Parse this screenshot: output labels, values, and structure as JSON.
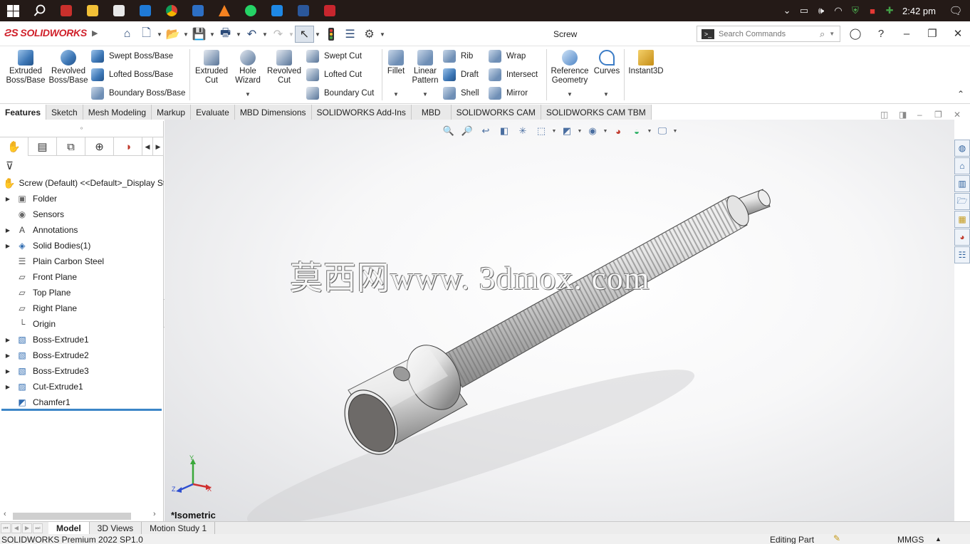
{
  "taskbar": {
    "clock": "2:42 pm",
    "apps": [
      "windows-start",
      "search",
      "calendar-2022",
      "file-explorer",
      "store",
      "mail",
      "chrome",
      "generic-app",
      "vlc",
      "whatsapp",
      "vscode",
      "word",
      "solidworks"
    ]
  },
  "app": {
    "brand": "SOLIDWORKS",
    "document_title": "Screw",
    "search_placeholder": "Search Commands"
  },
  "ribbon": {
    "extruded_boss": "Extruded Boss/Base",
    "revolved_boss": "Revolved Boss/Base",
    "swept_boss": "Swept Boss/Base",
    "lofted_boss": "Lofted Boss/Base",
    "boundary_boss": "Boundary Boss/Base",
    "extruded_cut": "Extruded Cut",
    "hole_wizard": "Hole Wizard",
    "revolved_cut": "Revolved Cut",
    "swept_cut": "Swept Cut",
    "lofted_cut": "Lofted Cut",
    "boundary_cut": "Boundary Cut",
    "fillet": "Fillet",
    "linear_pattern": "Linear Pattern",
    "rib": "Rib",
    "draft": "Draft",
    "shell": "Shell",
    "wrap": "Wrap",
    "intersect": "Intersect",
    "mirror": "Mirror",
    "reference_geometry": "Reference Geometry",
    "curves": "Curves",
    "instant3d": "Instant3D"
  },
  "cm_tabs": [
    "Features",
    "Sketch",
    "Mesh Modeling",
    "Markup",
    "Evaluate",
    "MBD Dimensions",
    "SOLIDWORKS Add-Ins",
    "MBD",
    "SOLIDWORKS CAM",
    "SOLIDWORKS CAM TBM"
  ],
  "tree": {
    "root": "Screw (Default) <<Default>_Display St",
    "items": [
      {
        "label": "Folder",
        "expandable": true,
        "icon": "folder-icon"
      },
      {
        "label": "Sensors",
        "expandable": false,
        "icon": "sensor-icon"
      },
      {
        "label": "Annotations",
        "expandable": true,
        "icon": "annotation-icon"
      },
      {
        "label": "Solid Bodies(1)",
        "expandable": true,
        "icon": "solid-bodies-icon"
      },
      {
        "label": "Plain Carbon Steel",
        "expandable": false,
        "icon": "material-icon"
      },
      {
        "label": "Front Plane",
        "expandable": false,
        "icon": "plane-icon"
      },
      {
        "label": "Top Plane",
        "expandable": false,
        "icon": "plane-icon"
      },
      {
        "label": "Right Plane",
        "expandable": false,
        "icon": "plane-icon"
      },
      {
        "label": "Origin",
        "expandable": false,
        "icon": "origin-icon"
      },
      {
        "label": "Boss-Extrude1",
        "expandable": true,
        "icon": "boss-extrude-icon"
      },
      {
        "label": "Boss-Extrude2",
        "expandable": true,
        "icon": "boss-extrude-icon"
      },
      {
        "label": "Boss-Extrude3",
        "expandable": true,
        "icon": "boss-extrude-icon"
      },
      {
        "label": "Cut-Extrude1",
        "expandable": true,
        "icon": "cut-extrude-icon"
      },
      {
        "label": "Chamfer1",
        "expandable": false,
        "icon": "chamfer-icon"
      }
    ]
  },
  "graphics": {
    "watermark": "莫西网www. 3dmox. com",
    "view_name": "*Isometric",
    "triad": {
      "x": "X",
      "y": "Y",
      "z": "Z"
    }
  },
  "bottom_tabs": [
    "Model",
    "3D Views",
    "Motion Study 1"
  ],
  "status": {
    "product": "SOLIDWORKS Premium 2022 SP1.0",
    "mode": "Editing Part",
    "units": "MMGS"
  },
  "colors": {
    "taskbar_bg": "#241a17",
    "brand_red": "#d0202a",
    "accent_blue": "#3c86c8"
  }
}
